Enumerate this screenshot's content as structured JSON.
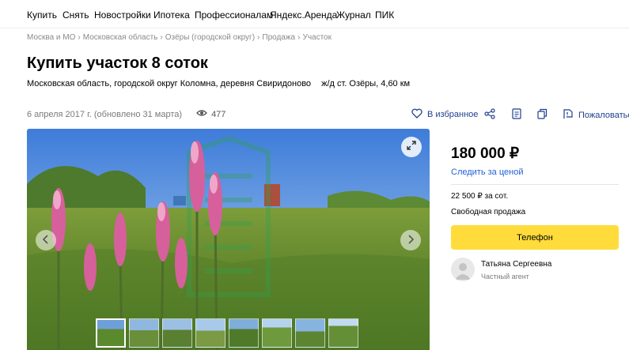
{
  "nav": [
    "Купить",
    "Снять",
    "Новостройки",
    "Ипотека",
    "Профессионалам",
    "Яндекс.Аренда",
    "Журнал",
    "ПИК"
  ],
  "breadcrumbs": [
    "Москва и МО",
    "Московская область",
    "Озёры (городской округ)",
    "Продажа",
    "Участок"
  ],
  "breadcrumb_separator": "›",
  "listing": {
    "title": "Купить участок 8 соток",
    "address": "Московская область, городской округ Коломна, деревня Свиридоново",
    "station": "ж/д ст. Озёры, 4,60 км",
    "date": "6 апреля 2017 г. (обновлено 31 марта)",
    "views": "477"
  },
  "actions": {
    "favorite": "В избранное",
    "complain": "Пожаловаться"
  },
  "sidebar": {
    "price": "180 000 ₽",
    "follow_price": "Следить за ценой",
    "price_per_unit": "22 500 ₽ за сот.",
    "deal_type": "Свободная продажа",
    "phone_button": "Телефон",
    "agent_name": "Татьяна Сергеевна",
    "agent_type": "Частный агент"
  },
  "colors": {
    "accent_link": "#1f5fd6",
    "phone_button": "#ffdc3b"
  },
  "icons": [
    "heart-icon",
    "share-icon",
    "document-icon",
    "copy-icon",
    "report-icon",
    "eye-icon",
    "expand-icon",
    "chevron-left-icon",
    "chevron-right-icon"
  ]
}
